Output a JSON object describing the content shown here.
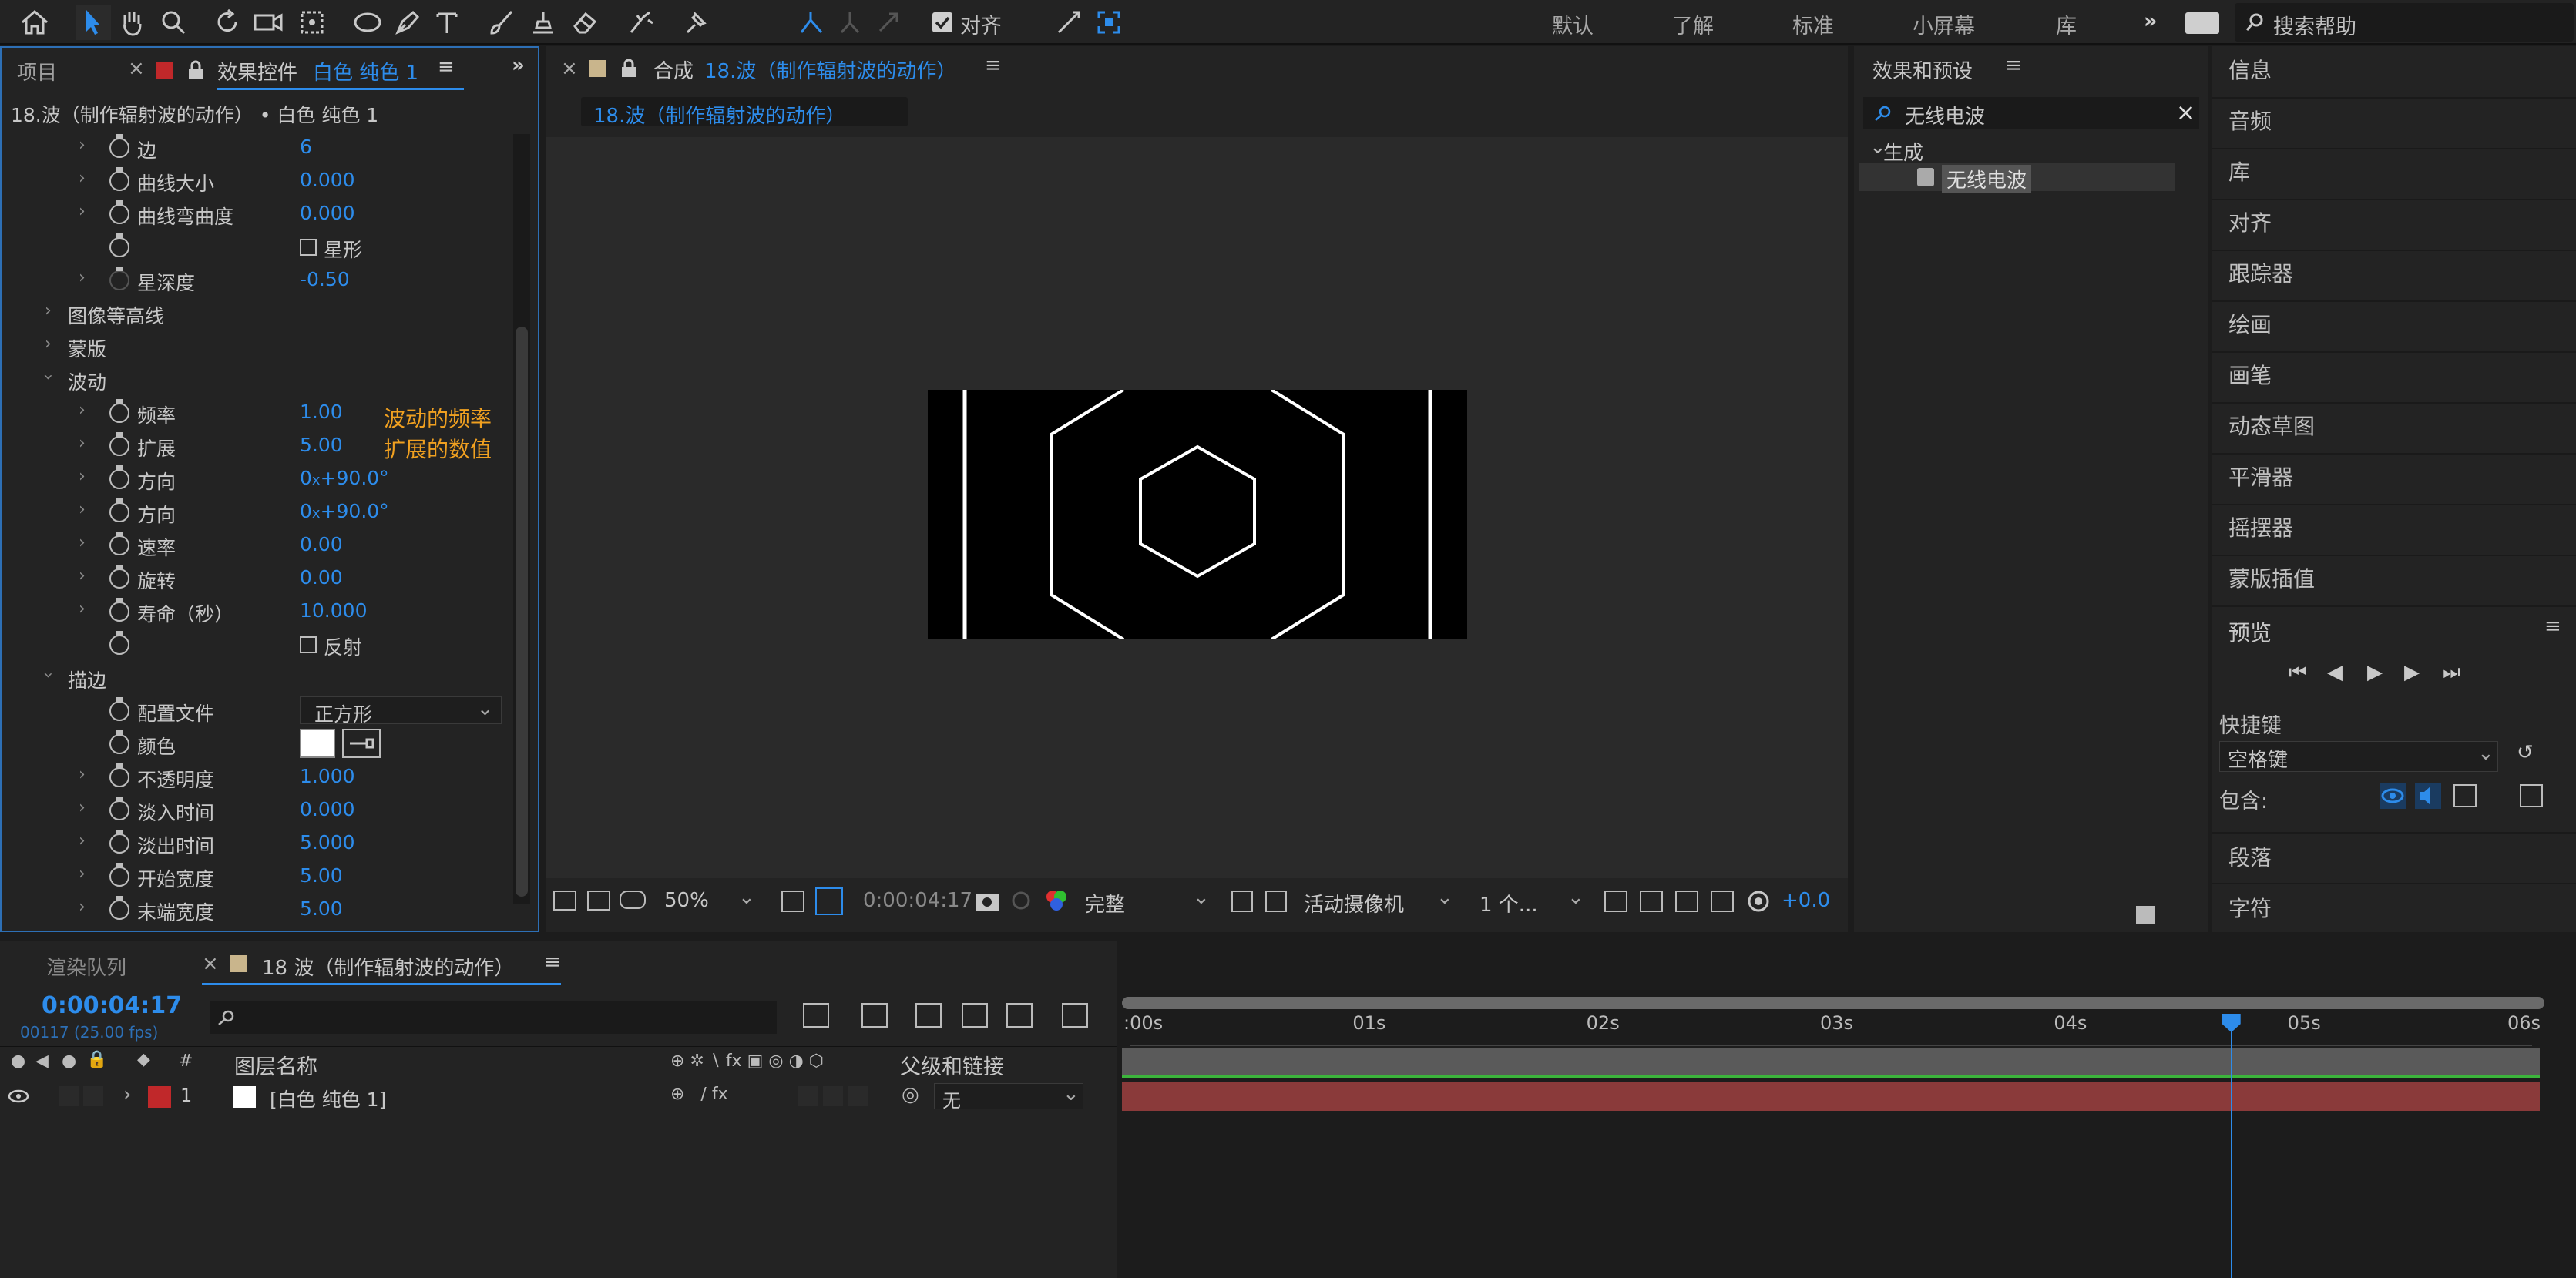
{
  "toolbar": {
    "align_label": "对齐",
    "workspaces": [
      "默认",
      "了解",
      "标准",
      "小屏幕",
      "库"
    ],
    "search_help_placeholder": "搜索帮助"
  },
  "effect_controls": {
    "tab_project": "项目",
    "tab_label_prefix": "效果控件",
    "tab_layer": "白色 纯色 1",
    "breadcrumb": "18.波（制作辐射波的动作） • 白色 纯色 1",
    "rows": [
      {
        "label": "边",
        "value": "6"
      },
      {
        "label": "曲线大小",
        "value": "0.000"
      },
      {
        "label": "曲线弯曲度",
        "value": "0.000"
      },
      {
        "label": "",
        "checkbox": "星形"
      },
      {
        "label": "星深度",
        "value": "-0.50"
      }
    ],
    "sections": {
      "contour": "图像等高线",
      "mask": "蒙版",
      "wave": "波动",
      "stroke": "描边"
    },
    "wave_rows": [
      {
        "label": "频率",
        "value": "1.00"
      },
      {
        "label": "扩展",
        "value": "5.00"
      },
      {
        "label": "方向",
        "value_a": "0",
        "value_b": "+90.0°"
      },
      {
        "label": "方向",
        "value_a": "0",
        "value_b": "+90.0°"
      },
      {
        "label": "速率",
        "value": "0.00"
      },
      {
        "label": "旋转",
        "value": "0.00"
      },
      {
        "label": "寿命（秒）",
        "value": "10.000"
      },
      {
        "label": "",
        "checkbox": "反射"
      }
    ],
    "annotation_line1": "波动的频率",
    "annotation_line2": "扩展的数值",
    "stroke_rows": [
      {
        "label": "配置文件",
        "select": "正方形"
      },
      {
        "label": "颜色"
      },
      {
        "label": "不透明度",
        "value": "1.000"
      },
      {
        "label": "淡入时间",
        "value": "0.000"
      },
      {
        "label": "淡出时间",
        "value": "5.000"
      },
      {
        "label": "开始宽度",
        "value": "5.00"
      },
      {
        "label": "末端宽度",
        "value": "5.00"
      }
    ]
  },
  "composition": {
    "tab_prefix": "合成",
    "tab_name": "18.波（制作辐射波的动作）",
    "sub_tab": "18.波（制作辐射波的动作）",
    "zoom": "50%",
    "timecode": "0:00:04:17",
    "resolution": "完整",
    "camera": "活动摄像机",
    "views": "1 个...",
    "exposure": "+0.0"
  },
  "effects_presets": {
    "title": "效果和预设",
    "search_value": "无线电波",
    "category": "生成",
    "item": "无线电波"
  },
  "right_panels": {
    "items": [
      "信息",
      "音频",
      "库",
      "对齐",
      "跟踪器",
      "绘画",
      "画笔",
      "动态草图",
      "平滑器",
      "摇摆器",
      "蒙版插值"
    ],
    "preview_title": "预览",
    "shortcut_label": "快捷键",
    "shortcut_value": "空格键",
    "include_label": "包含:",
    "bottom_items": [
      "段落",
      "字符"
    ]
  },
  "timeline": {
    "tab_render": "渲染队列",
    "tab_comp": "18 波（制作辐射波的动作）",
    "timecode": "0:00:04:17",
    "frame_info": "00117 (25.00 fps)",
    "col_layer_name": "图层名称",
    "col_parent": "父级和链接",
    "col_num": "#",
    "layer_num": "1",
    "layer_name": "[白色 纯色 1]",
    "parent_value": "无",
    "ruler": [
      ":00s",
      "01s",
      "02s",
      "03s",
      "04s",
      "05s",
      "06s"
    ],
    "playhead_fraction": 0.785
  },
  "colors": {
    "accent_blue": "#2d8ceb",
    "annotation_orange": "#f0a020",
    "layer_bar": "#8a3a3a",
    "layer_label_red": "#c0282a"
  }
}
